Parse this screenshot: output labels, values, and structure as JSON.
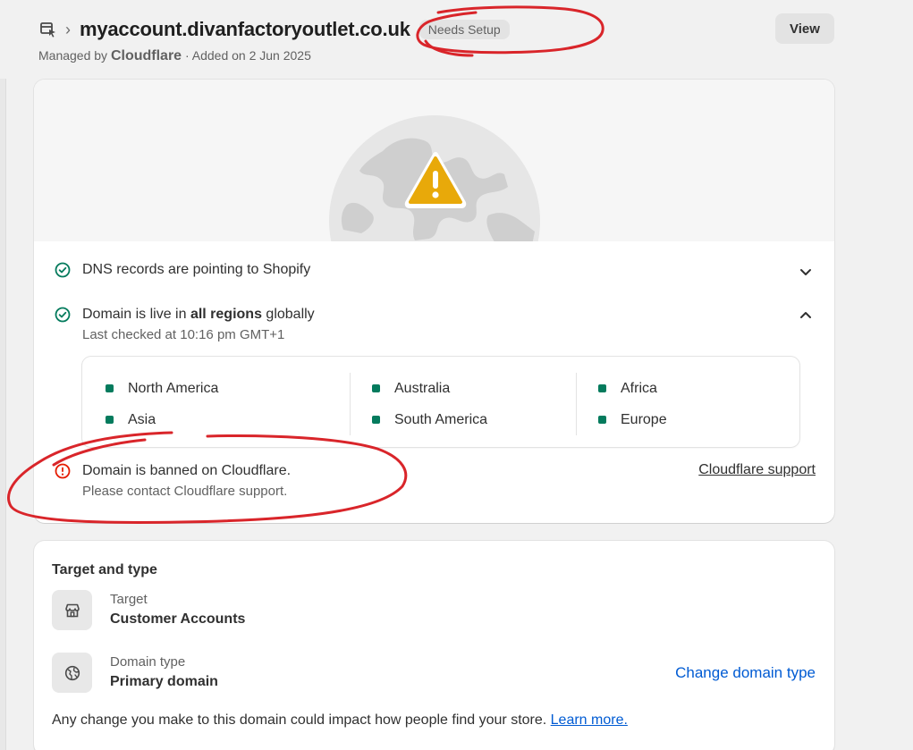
{
  "header": {
    "domain": "myaccount.divanfactoryoutlet.co.uk",
    "breadcrumb_sep": "›",
    "status_badge": "Needs Setup",
    "view_label": "View",
    "managed_by_prefix": "Managed by",
    "managed_by": "Cloudflare",
    "added_on": "· Added on 2 Jun 2025"
  },
  "status_card": {
    "dns": {
      "text": "DNS records are pointing to Shopify"
    },
    "live": {
      "text_before": "Domain is live in",
      "text_bold": "all regions",
      "text_after": "globally",
      "last_checked": "Last checked at 10:16 pm GMT+1"
    },
    "regions": [
      [
        "North America",
        "Asia"
      ],
      [
        "Australia",
        "South America"
      ],
      [
        "Africa",
        "Europe"
      ]
    ],
    "banned": {
      "text": "Domain is banned on Cloudflare.",
      "sub": "Please contact Cloudflare support.",
      "link": "Cloudflare support"
    }
  },
  "target_card": {
    "title": "Target and type",
    "target_label": "Target",
    "target_value": "Customer Accounts",
    "type_label": "Domain type",
    "type_value": "Primary domain",
    "change_link": "Change domain type",
    "note": "Any change you make to this domain could impact how people find your store.",
    "learn_more": "Learn more."
  },
  "colors": {
    "success": "#047b5d",
    "critical": "#e51c00",
    "warning": "#e8a90a",
    "link": "#005bd3",
    "annotation": "#d9252a"
  },
  "icons": [
    "domain-icon",
    "chevron-down-icon",
    "chevron-up-icon",
    "check-circle-icon",
    "alert-circle-icon",
    "warning-triangle-icon",
    "globe-icon",
    "store-icon"
  ]
}
